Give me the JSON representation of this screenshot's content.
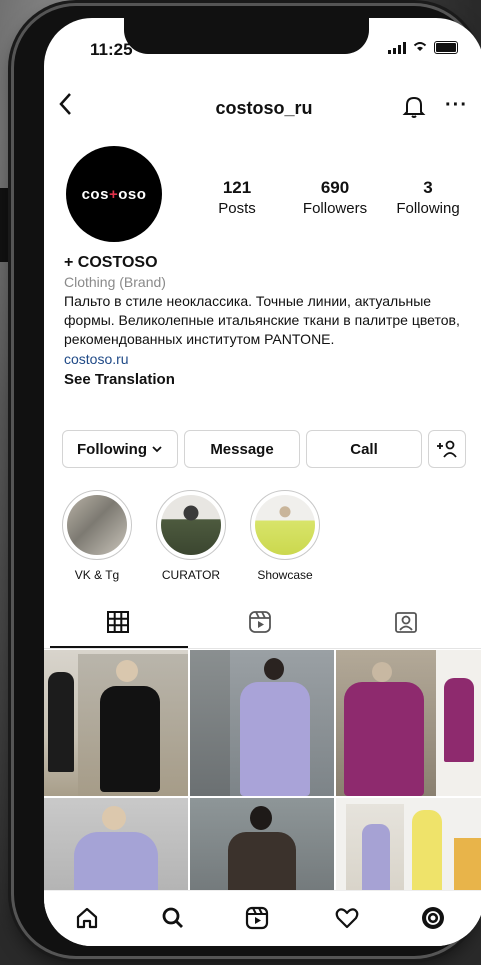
{
  "status": {
    "time": "11:25"
  },
  "header": {
    "username": "costoso_ru"
  },
  "profile": {
    "avatar_text_left": "cos",
    "avatar_text_plus": "+",
    "avatar_text_right": "oso",
    "stats": [
      {
        "value": "121",
        "label": "Posts"
      },
      {
        "value": "690",
        "label": "Followers"
      },
      {
        "value": "3",
        "label": "Following"
      }
    ],
    "name": "+ COSTOSO",
    "category": "Clothing (Brand)",
    "bio": "Пальто в стиле неоклассика. Точные линии, актуальные формы. Великолепные итальянские ткани в палитре цветов, рекомендованных институтом PANTONE.",
    "link": "costoso.ru",
    "see_translation": "See Translation"
  },
  "actions": {
    "following": "Following",
    "message": "Message",
    "call": "Call"
  },
  "highlights": [
    {
      "label": "VK & Tg"
    },
    {
      "label": "CURATOR"
    },
    {
      "label": "Showcase"
    }
  ],
  "tabs": {
    "active": "grid",
    "icons": [
      "grid-icon",
      "reels-icon",
      "tagged-icon"
    ]
  },
  "bottom_nav": {
    "icons": [
      "home-icon",
      "search-icon",
      "reels-icon",
      "heart-icon",
      "profile-icon"
    ]
  },
  "colors": {
    "brand_plus": "#e0324a",
    "link": "#204a87",
    "muted": "#8a8a8a"
  }
}
